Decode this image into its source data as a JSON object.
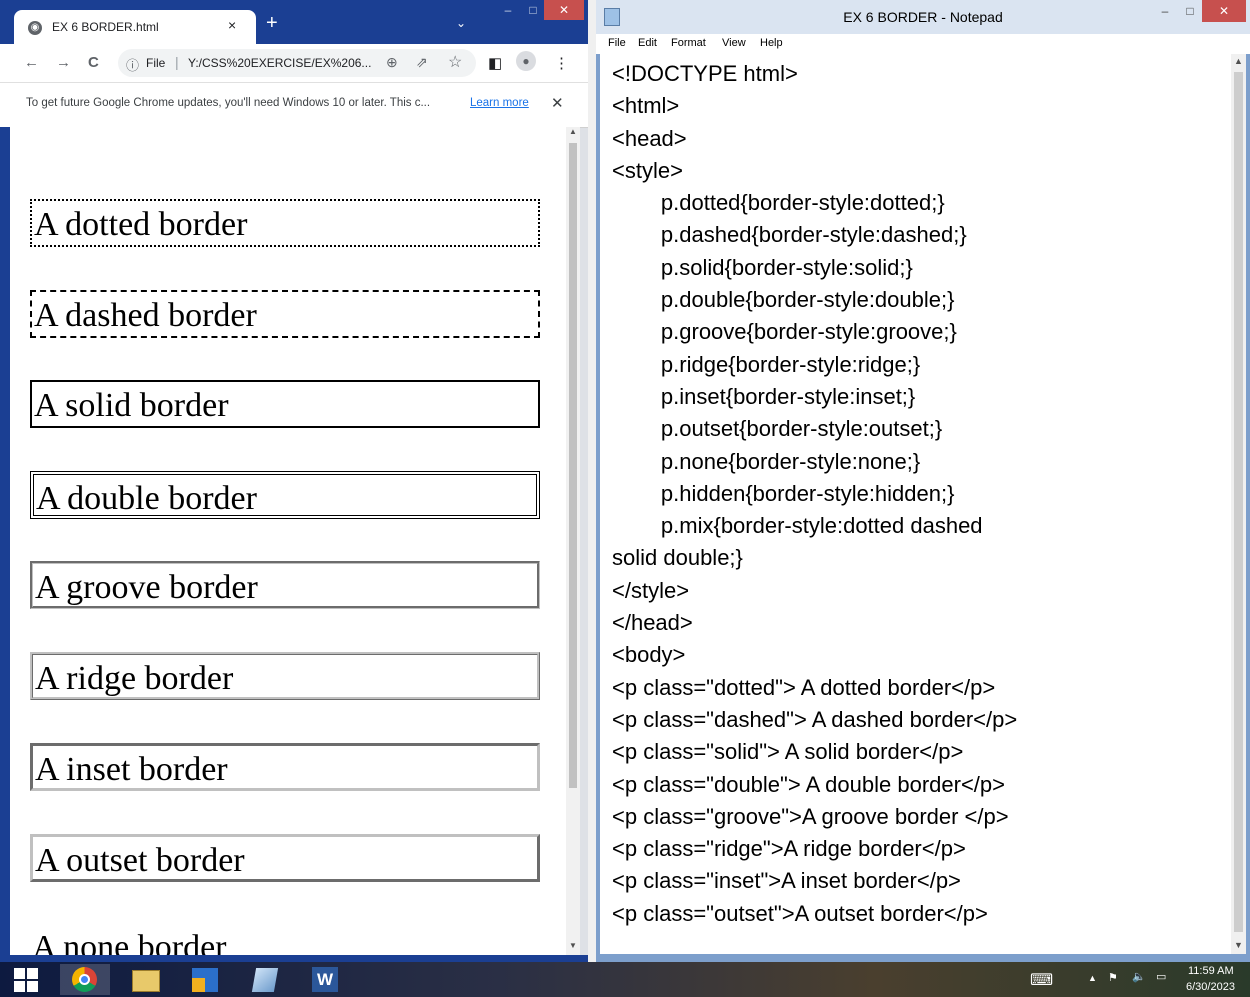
{
  "chrome": {
    "tab_title": "EX 6 BORDER.html",
    "tab_close": "×",
    "new_tab": "+",
    "tab_search": "⌄",
    "window_buttons": [
      "–",
      "□",
      "✕"
    ],
    "nav": {
      "back": "←",
      "forward": "→",
      "reload": "C"
    },
    "address": {
      "info": "ⓘ",
      "scheme_label": "File",
      "separator": "|",
      "url": "Y:/CSS%20EXERCISE/EX%206..."
    },
    "toolbar_icons": {
      "zoom": "⊕",
      "share": "⇗",
      "bookmark": "☆",
      "sidepanel": "◧",
      "profile": "●",
      "menu": "⋮"
    },
    "infobar": {
      "message": "To get future Google Chrome updates, you'll need Windows 10 or later. This c...",
      "link": "Learn more",
      "close": "✕"
    },
    "content_paragraphs": [
      "A dotted border",
      "A dashed border",
      "A solid border",
      "A double border",
      "A groove border",
      "A ridge border",
      "A inset border",
      "A outset border",
      "A none border"
    ],
    "scroll_up": "▲",
    "scroll_down": "▼"
  },
  "notepad": {
    "title": "EX 6 BORDER - Notepad",
    "window_buttons": [
      "–",
      "□",
      "✕"
    ],
    "menu": [
      "File",
      "Edit",
      "Format",
      "View",
      "Help"
    ],
    "code": "<!DOCTYPE html>\n<html>\n<head>\n<style>\n\t\tp.dotted{border-style:dotted;}\n\t\tp.dashed{border-style:dashed;}\n\t\tp.solid{border-style:solid;}\n\t\tp.double{border-style:double;}\n\t\tp.groove{border-style:groove;}\n\t\tp.ridge{border-style:ridge;}\n\t\tp.inset{border-style:inset;}\n\t\tp.outset{border-style:outset;}\n\t\tp.none{border-style:none;}\n\t\tp.hidden{border-style:hidden;}\n\t\tp.mix{border-style:dotted dashed\nsolid double;}\n</style>\n</head>\n<body>\n<p class=\"dotted\"> A dotted border</p>\n<p class=\"dashed\"> A dashed border</p>\n<p class=\"solid\"> A solid border</p>\n<p class=\"double\"> A double border</p>\n<p class=\"groove\">A groove border </p>\n<p class=\"ridge\">A ridge border</p>\n<p class=\"inset\">A inset border</p>\n<p class=\"outset\">A outset border</p>",
    "scroll_up": "▲",
    "scroll_down": "▼"
  },
  "taskbar": {
    "apps": [
      "start-icon",
      "chrome-icon",
      "file-explorer-icon",
      "window-icon",
      "notepad-icon",
      "word-icon"
    ],
    "word_letter": "W",
    "tray": {
      "keyboard": "⌨",
      "show_hidden": "▲",
      "flag": "⚑",
      "volume": "🔈",
      "network": "▭"
    },
    "time": "11:59 AM",
    "date": "6/30/2023"
  },
  "colors": {
    "chrome_frame": "#1b3f93",
    "link": "#1a73e8",
    "notepad_title": "#dae4f1",
    "notepad_close": "#c7504e"
  }
}
